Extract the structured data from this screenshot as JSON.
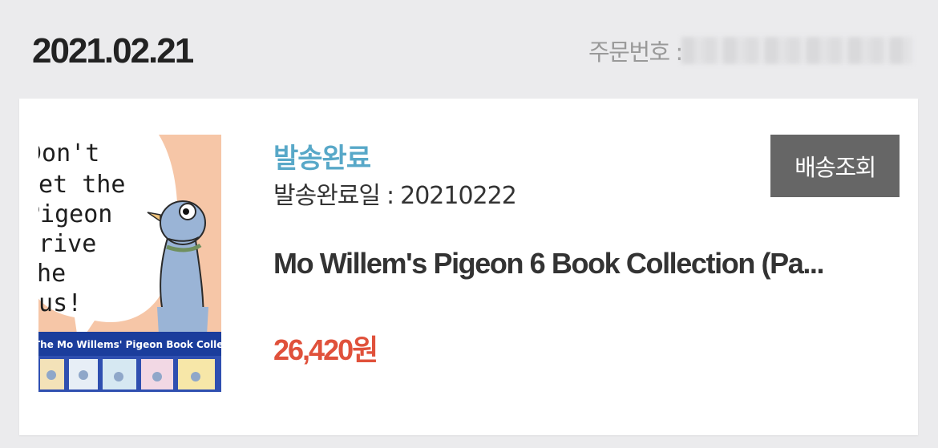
{
  "order": {
    "date": "2021.02.21",
    "number_label": "주문번호 :",
    "number_value_redacted": true
  },
  "delivery": {
    "status": "발송완료",
    "date_label": "발송완료일",
    "date_separator": ":",
    "date_value": "20210222",
    "track_button_label": "배송조회"
  },
  "product": {
    "title": "Mo Willem's Pigeon 6 Book Collection (Pa...",
    "price": "26,420",
    "currency": "원",
    "thumbnail": {
      "cover_lines": [
        "Don't",
        "Let the",
        "Pigeon",
        "Drive",
        "the",
        "Bus!"
      ],
      "banner_text": "The Mo Willems' Pigeon Book Colle"
    }
  },
  "colors": {
    "page_background": "#ebebed",
    "card_background": "#ffffff",
    "status_color": "#58a8c8",
    "price_color": "#e0513b",
    "button_background": "#666666"
  }
}
